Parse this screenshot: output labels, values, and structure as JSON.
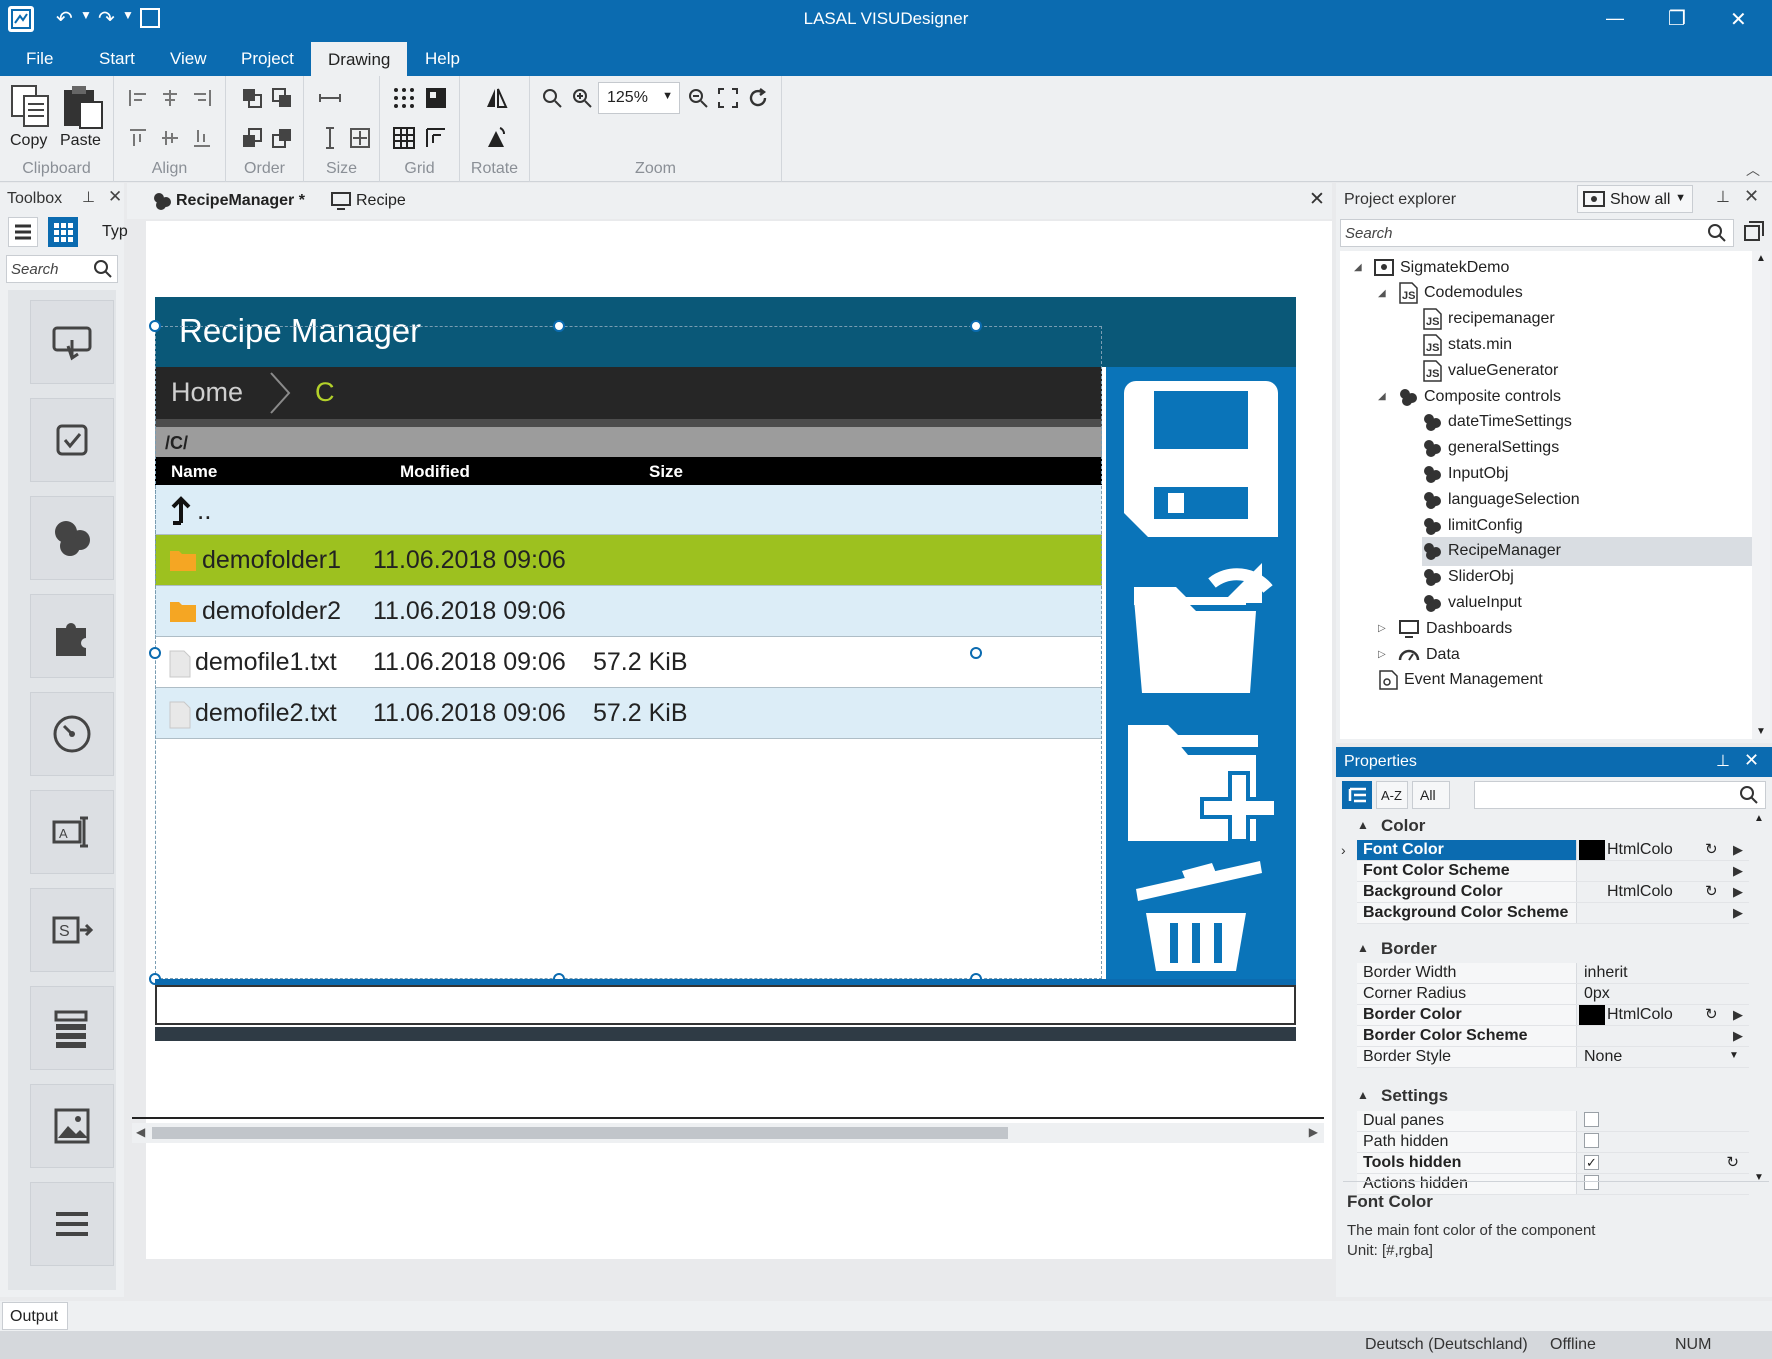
{
  "window": {
    "title": "LASAL VISUDesigner",
    "minimize": "—",
    "restore": "❐",
    "close": "✕"
  },
  "menu": {
    "items": [
      {
        "label": "File"
      },
      {
        "label": "Start"
      },
      {
        "label": "View"
      },
      {
        "label": "Project"
      },
      {
        "label": "Drawing"
      },
      {
        "label": "Help"
      }
    ]
  },
  "ribbon": {
    "clipboard": {
      "copy": "Copy",
      "paste": "Paste",
      "label": "Clipboard"
    },
    "align_label": "Align",
    "order_label": "Order",
    "size_label": "Size",
    "grid_label": "Grid",
    "rotate_label": "Rotate",
    "zoom_label": "Zoom",
    "zoom_value": "125%"
  },
  "toolbox": {
    "title": "Toolbox",
    "type_label": "Typ",
    "search_placeholder": "Search"
  },
  "tabs": [
    {
      "label": "RecipeManager *"
    },
    {
      "label": "Recipe"
    }
  ],
  "canvas": {
    "header_title": "Recipe Manager",
    "breadcrumb_home": "Home",
    "breadcrumb_current": "C",
    "path": "/C/",
    "columns": [
      "Name",
      "Modified",
      "Size"
    ],
    "up_label": "..",
    "rows": [
      {
        "name": "demofolder1",
        "modified": "11.06.2018 09:06",
        "size": "",
        "type": "folder"
      },
      {
        "name": "demofolder2",
        "modified": "11.06.2018 09:06",
        "size": "",
        "type": "folder"
      },
      {
        "name": "demofile1.txt",
        "modified": "11.06.2018 09:06",
        "size": "57.2 KiB",
        "type": "file"
      },
      {
        "name": "demofile2.txt",
        "modified": "11.06.2018 09:06",
        "size": "57.2 KiB",
        "type": "file"
      }
    ]
  },
  "project_explorer": {
    "title": "Project explorer",
    "show_all": "Show all",
    "search_placeholder": "Search",
    "items": [
      {
        "label": "SigmatekDemo",
        "level": 0
      },
      {
        "label": "Codemodules",
        "level": 1
      },
      {
        "label": "recipemanager",
        "level": 2
      },
      {
        "label": "stats.min",
        "level": 2
      },
      {
        "label": "valueGenerator",
        "level": 2
      },
      {
        "label": "Composite controls",
        "level": 1
      },
      {
        "label": "dateTimeSettings",
        "level": 2
      },
      {
        "label": "generalSettings",
        "level": 2
      },
      {
        "label": "InputObj",
        "level": 2
      },
      {
        "label": "languageSelection",
        "level": 2
      },
      {
        "label": "limitConfig",
        "level": 2
      },
      {
        "label": "RecipeManager",
        "level": 2
      },
      {
        "label": "SliderObj",
        "level": 2
      },
      {
        "label": "valueInput",
        "level": 2
      },
      {
        "label": "Dashboards",
        "level": 1
      },
      {
        "label": "Data",
        "level": 1
      },
      {
        "label": "Event Management",
        "level": 1
      }
    ]
  },
  "properties": {
    "title": "Properties",
    "az": "A-Z",
    "all": "All",
    "categories": {
      "color": "Color",
      "border": "Border",
      "settings": "Settings"
    },
    "color_rows": [
      {
        "name": "Font Color",
        "value": "HtmlColo"
      },
      {
        "name": "Font Color Scheme",
        "value": ""
      },
      {
        "name": "Background Color",
        "value": "HtmlColo"
      },
      {
        "name": "Background Color Scheme",
        "value": ""
      }
    ],
    "border_rows": [
      {
        "name": "Border Width",
        "value": "inherit"
      },
      {
        "name": "Corner Radius",
        "value": "0px"
      },
      {
        "name": "Border Color",
        "value": "HtmlColo"
      },
      {
        "name": "Border Color Scheme",
        "value": ""
      },
      {
        "name": "Border Style",
        "value": "None"
      }
    ],
    "settings_rows": [
      {
        "name": "Dual panes",
        "checked": false
      },
      {
        "name": "Path hidden",
        "checked": false
      },
      {
        "name": "Tools hidden",
        "checked": true
      },
      {
        "name": "Actions hidden",
        "checked": false
      }
    ],
    "desc_title": "Font Color",
    "desc_text": "The main font color of the component",
    "desc_unit": "Unit: [#,rgba]"
  },
  "output_tab": "Output",
  "status": {
    "language": "Deutsch (Deutschland)",
    "mode": "Offline",
    "num": "NUM"
  },
  "colors": {
    "accent": "#0b6bb0",
    "header": "#0a5878",
    "selected_row": "#9dc11f",
    "side_tools": "#0a74b9",
    "folder": "#f5a623"
  }
}
